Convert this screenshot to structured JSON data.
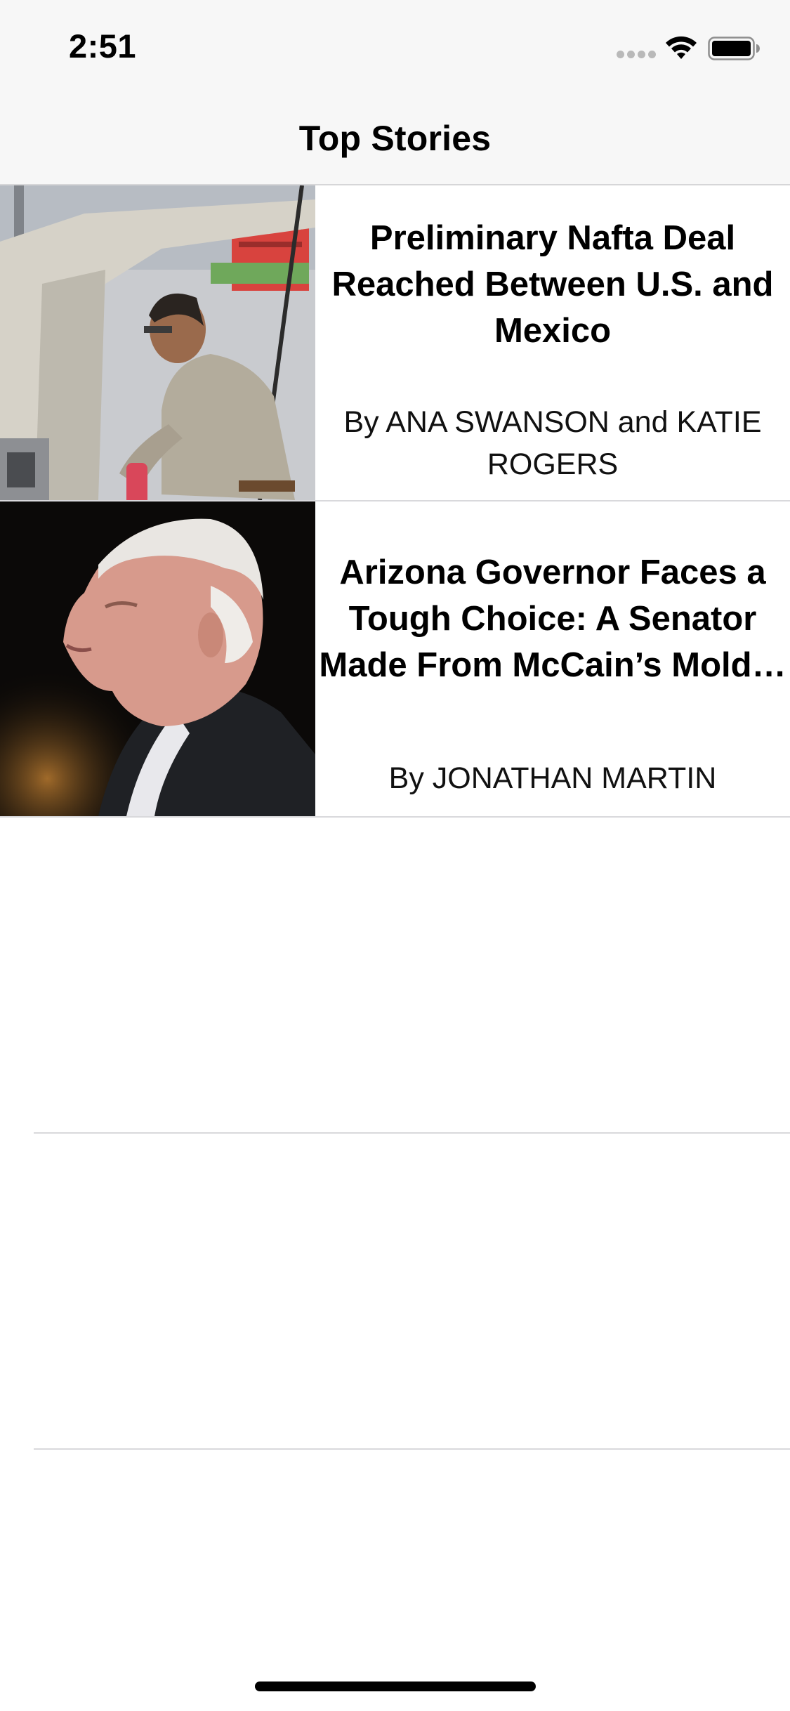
{
  "status_bar": {
    "time": "2:51",
    "icons": [
      "cellular-signal-icon",
      "wifi-icon",
      "battery-icon"
    ]
  },
  "nav": {
    "title": "Top Stories"
  },
  "stories": [
    {
      "headline": "Preliminary Nafta Deal Reached Between U.S. and Mexico",
      "byline": "By ANA SWANSON and KATIE ROGERS",
      "image": "factory-worker-photo"
    },
    {
      "headline": "Arizona Governor Faces a Tough Choice: A Senator Made From McCain’s Mold…",
      "byline": "By JONATHAN MARTIN",
      "image": "senator-portrait-photo"
    }
  ],
  "colors": {
    "nav_background": "#f7f7f7",
    "separator": "#d9d9dc",
    "text": "#000000"
  }
}
